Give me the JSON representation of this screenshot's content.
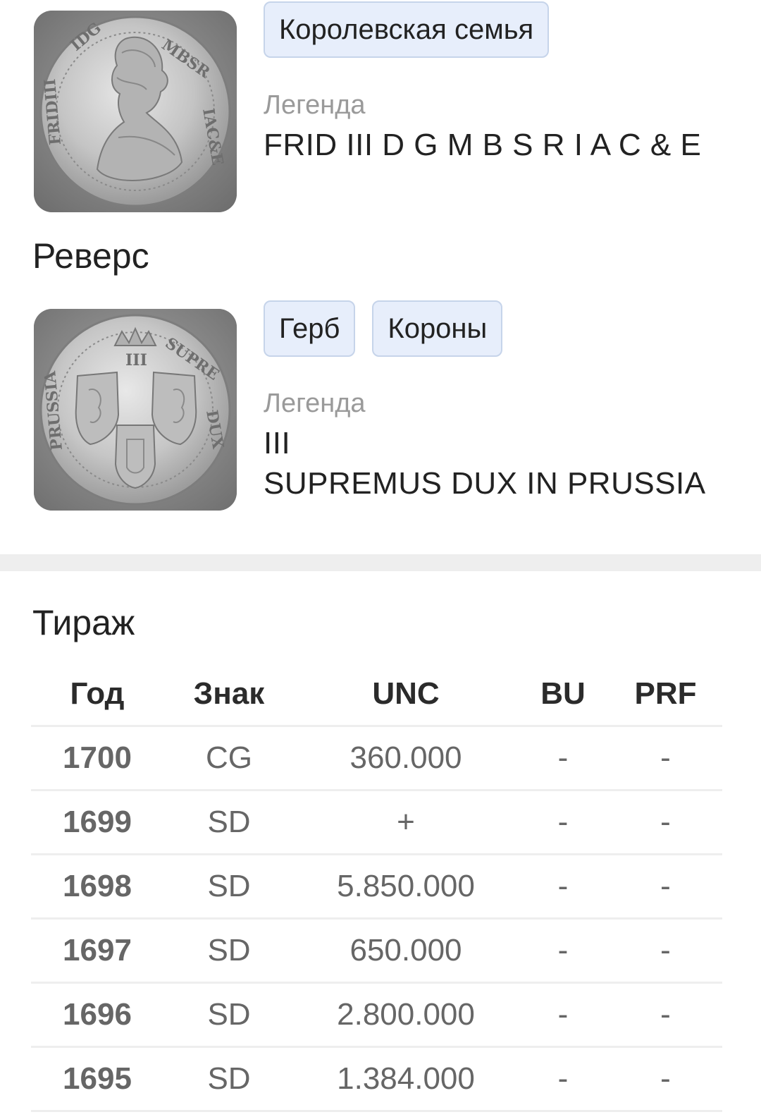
{
  "obverse": {
    "tags": [
      "Королевская семья"
    ],
    "legend_label": "Легенда",
    "legend_lines": [
      "FRID III D G M B S R I A C & E"
    ]
  },
  "reverse": {
    "section_title": "Реверс",
    "tags": [
      "Герб",
      "Короны"
    ],
    "legend_label": "Легенда",
    "legend_lines": [
      "III",
      "SUPREMUS DUX IN PRUSSIA"
    ]
  },
  "mintage": {
    "title": "Тираж",
    "columns": [
      "Год",
      "Знак",
      "UNC",
      "BU",
      "PRF"
    ],
    "rows": [
      [
        "1700",
        "CG",
        "360.000",
        "-",
        "-"
      ],
      [
        "1699",
        "SD",
        "+",
        "-",
        "-"
      ],
      [
        "1698",
        "SD",
        "5.850.000",
        "-",
        "-"
      ],
      [
        "1697",
        "SD",
        "650.000",
        "-",
        "-"
      ],
      [
        "1696",
        "SD",
        "2.800.000",
        "-",
        "-"
      ],
      [
        "1695",
        "SD",
        "1.384.000",
        "-",
        "-"
      ]
    ]
  },
  "colors": {
    "tag_background": "#e7eefb",
    "tag_border": "#c6d4ea",
    "legend_label": "#9a9a9a",
    "divider": "#eeeeee"
  }
}
